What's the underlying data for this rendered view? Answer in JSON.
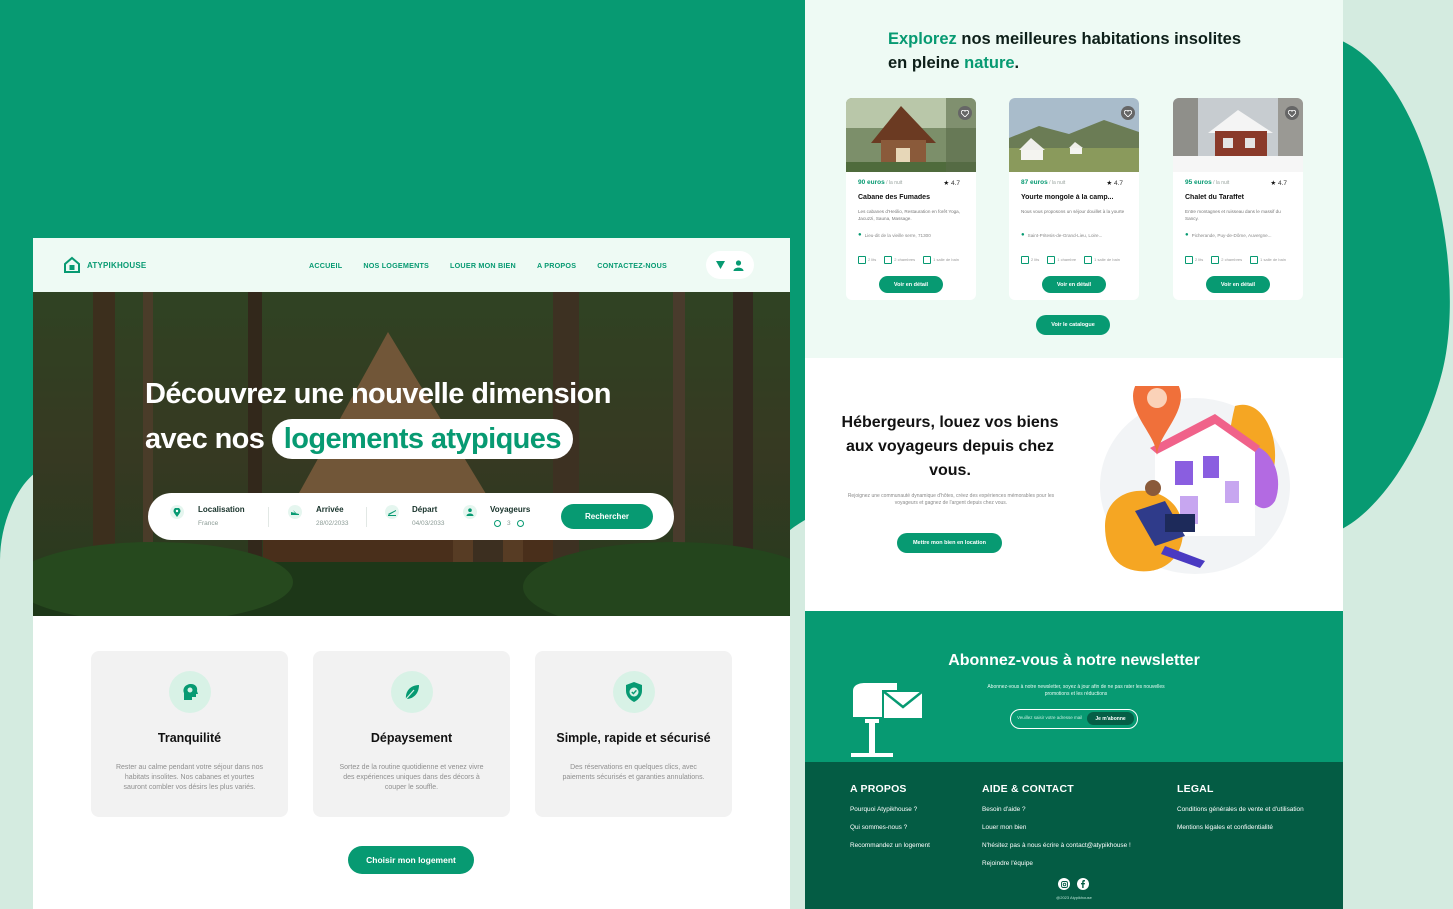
{
  "nav": {
    "brand": "ATYPIKHOUSE",
    "menu": [
      "ACCUEIL",
      "NOS LOGEMENTS",
      "LOUER MON BIEN",
      "A PROPOS",
      "CONTACTEZ-NOUS"
    ]
  },
  "hero": {
    "line1": "Découvrez une nouvelle  dimension",
    "line2_prefix": "avec nos",
    "line2_highlight": "logements  atypiques"
  },
  "search": {
    "location_label": "Localisation",
    "location_value": "France",
    "arrival_label": "Arrivée",
    "arrival_value": "28/02/2033",
    "departure_label": "Départ",
    "departure_value": "04/03/2033",
    "travelers_label": "Voyageurs",
    "travelers_count": "3",
    "button": "Rechercher"
  },
  "features": [
    {
      "title": "Tranquilité",
      "desc": "Rester au calme pendant votre séjour dans nos habitats insolites. Nos cabanes et yourtes sauront combler vos désirs les plus variés."
    },
    {
      "title": "Dépaysement",
      "desc": "Sortez de la routine quotidienne et venez vivre des expériences uniques dans des décors à couper le souffle."
    },
    {
      "title": "Simple, rapide et sécurisé",
      "desc": "Des réservations en quelques clics, avec paiements sécurisés et garanties annulations."
    }
  ],
  "choose_button": "Choisir mon logement",
  "explore": {
    "title_green1": "Explorez",
    "title_rest1": " nos meilleures habitations insolites",
    "title_prefix2": "en pleine ",
    "title_green2": "nature",
    "title_suffix2": "."
  },
  "cards": [
    {
      "price": "90 euros",
      "per_night": " / la nuit",
      "rating": "4.7",
      "name": "Cabane des Fumades",
      "desc": "Les cabanes d'Heólio, Restauration en forêt Yoga, Jacuzzi, Sauna, Massage.",
      "location": "Lieu-dit de la vieille serre, 71300",
      "amenities": [
        "2 lits",
        "2 chambres",
        "1 salle de bain"
      ],
      "button": "Voir en détail"
    },
    {
      "price": "87 euros",
      "per_night": " / la nuit",
      "rating": "4.7",
      "name": "Yourte mongole à la camp...",
      "desc": "Nous vous proposons un séjour douillet à la yourte",
      "location": "Saint-Pritesis-de-Grand-Lieu, Loire...",
      "amenities": [
        "2 lits",
        "1 chambre",
        "1 salle de bain"
      ],
      "button": "Voir en détail"
    },
    {
      "price": "95 euros",
      "per_night": " / la nuit",
      "rating": "4.7",
      "name": "Chalet du Taraffet",
      "desc": "Entre montagnes et ruisseau dans le massif du Sancy.",
      "location": "Picherande, Puy-de-Dôme, Auvergne...",
      "amenities": [
        "2 lits",
        "2 chambres",
        "1 salle de bain"
      ],
      "button": "Voir en détail"
    }
  ],
  "catalog_button": "Voir le catalogue",
  "host": {
    "title": "Hébergeurs, louez vos biens aux voyageurs depuis chez vous.",
    "desc": "Rejoignez une communauté dynamique d'hôtes, créez des expériences mémorables pour les voyageurs et gagnez de l'argent depuis chez vous.",
    "button": "Mettre mon bien en location"
  },
  "newsletter": {
    "title": "Abonnez-vous à notre newsletter",
    "desc": "Abonnez-vous à notre newsletter, soyez à jour afin de ne pas rater les nouvelles promotions et les réductions",
    "placeholder": "Veuillez saisir votre adresse mail",
    "button": "Je m'abonne"
  },
  "footer": {
    "col1": {
      "title": "A PROPOS",
      "links": [
        "Pourquoi Atypikhouse ?",
        "Qui sommes-nous ?",
        "Recommandez un logement"
      ]
    },
    "col2": {
      "title": "AIDE & CONTACT",
      "links": [
        "Besoin d'aide ?",
        "Louer mon bien",
        "N'hésitez pas à nous écrire à contact@atypikhouse !",
        "Rejoindre l'équipe"
      ]
    },
    "col3": {
      "title": "LEGAL",
      "links": [
        "Conditions générales de vente et d'utilisation",
        "Mentions légales et confidentialité"
      ]
    },
    "copyright": "@2023 Atypikhouse"
  },
  "colors": {
    "primary": "#079a72",
    "dark": "#045c44",
    "mint": "#eefaf4",
    "background": "#d4ebe0"
  }
}
